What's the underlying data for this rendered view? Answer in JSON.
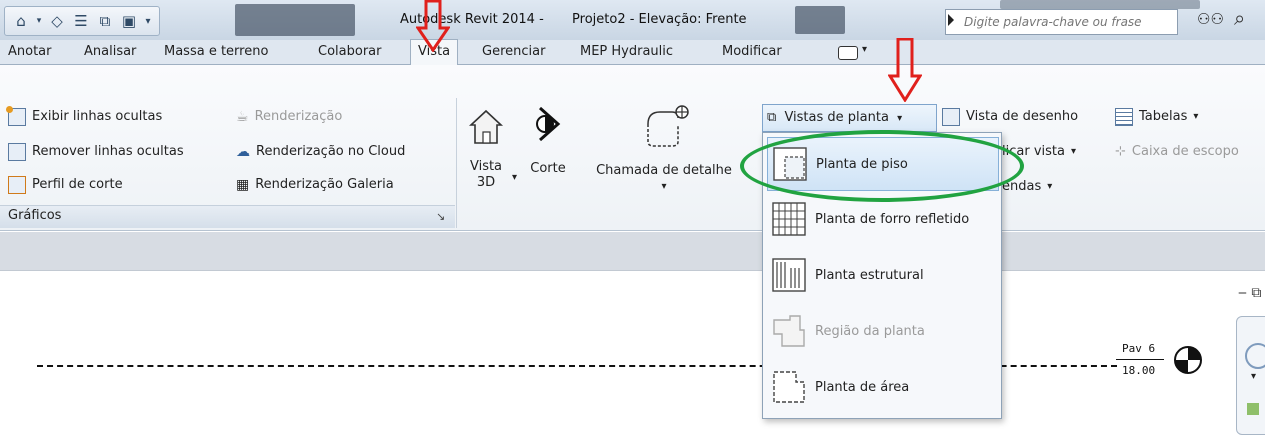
{
  "title_bar": {
    "app": "Autodesk Revit 2014 -",
    "project": "Projeto2 - Elevação: Frente",
    "search_placeholder": "Digite palavra-chave ou frase"
  },
  "tabs": [
    {
      "label": "Anotar"
    },
    {
      "label": "Analisar"
    },
    {
      "label": "Massa e terreno"
    },
    {
      "label": "Colaborar"
    },
    {
      "label": "Vista",
      "active": true
    },
    {
      "label": "Gerenciar"
    },
    {
      "label": "MEP Hydraulic"
    },
    {
      "label": "Modificar"
    }
  ],
  "ribbon": {
    "graphics": {
      "items": [
        {
          "label": "Exibir  linhas ocultas"
        },
        {
          "label": "Remover linhas ocultas"
        },
        {
          "label": "Perfil  de corte"
        }
      ],
      "render": [
        {
          "label": "Renderização",
          "disabled": true
        },
        {
          "label": "Renderização  no Cloud"
        },
        {
          "label": "Renderização  Galeria"
        }
      ],
      "panel_label": "Gráficos"
    },
    "create": {
      "vista3d_line1": "Vista",
      "vista3d_line2": "3D",
      "corte": "Corte",
      "chamada": "Chamada de detalhe",
      "vistas_planta": "Vistas de  planta",
      "vista_desenho": "Vista de  desenho",
      "tabelas": "Tabelas",
      "duplicar_vista_partial": "licar vista",
      "caixa_escopo_partial": "Caixa de  escopo",
      "legendas_partial": "endas"
    }
  },
  "dropdown": {
    "items": [
      {
        "label": "Planta de piso",
        "highlighted": true
      },
      {
        "label": "Planta de forro refletido"
      },
      {
        "label": "Planta estrutural"
      },
      {
        "label": "Região da planta",
        "disabled": true
      },
      {
        "label": "Planta de área"
      }
    ]
  },
  "canvas": {
    "level_name": "Pav 6",
    "level_elevation": "18.00"
  },
  "colors": {
    "highlight_ring": "#21a341",
    "annotation_arrow": "#e0201c"
  }
}
